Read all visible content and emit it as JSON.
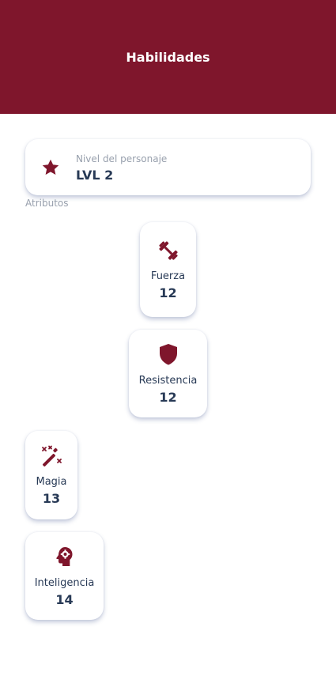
{
  "header": {
    "title": "Habilidades",
    "background_color": "#7f162c"
  },
  "level": {
    "icon": "star-icon",
    "label": "Nivel del personaje",
    "value": "LVL 2"
  },
  "attributes_section": {
    "label": "Atributos"
  },
  "attributes": [
    {
      "icon": "dumbbell-icon",
      "name": "Fuerza",
      "value": "12"
    },
    {
      "icon": "shield-icon",
      "name": "Resistencia",
      "value": "12"
    },
    {
      "icon": "magic-wand-icon",
      "name": "Magia",
      "value": "13"
    },
    {
      "icon": "brain-gear-icon",
      "name": "Inteligencia",
      "value": "14"
    }
  ],
  "colors": {
    "accent": "#7f162c",
    "text_primary": "#283a56",
    "text_muted": "#98a0ad"
  }
}
